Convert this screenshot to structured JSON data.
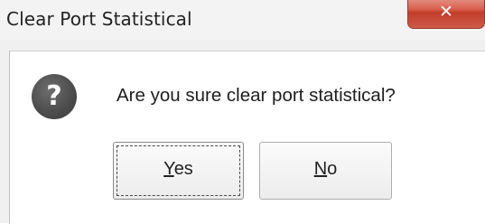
{
  "window": {
    "title": "Clear Port Statistical",
    "close_glyph": "✕"
  },
  "dialog": {
    "icon": "question-icon",
    "icon_glyph": "?",
    "message": "Are you sure clear port statistical?"
  },
  "buttons": {
    "yes": {
      "mnemonic": "Y",
      "rest": "es"
    },
    "no": {
      "mnemonic": "N",
      "rest": "o"
    }
  },
  "colors": {
    "close_button": "#d9604f",
    "icon_fill": "#4b4b4b"
  }
}
